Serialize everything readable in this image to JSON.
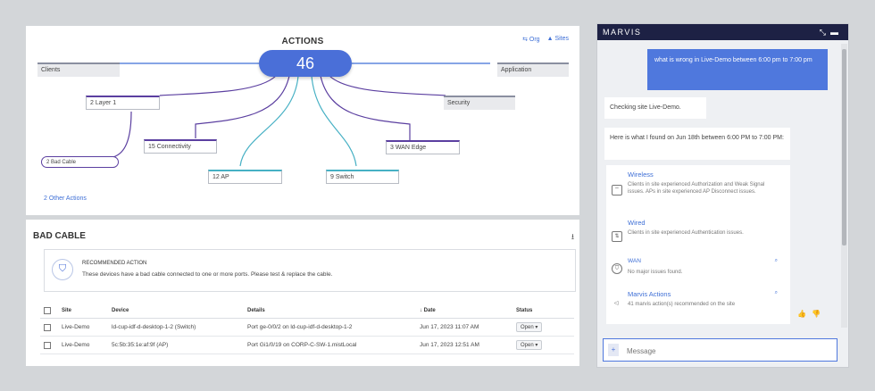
{
  "actions": {
    "title": "ACTIONS",
    "toggle_org": "Org",
    "toggle_sites": "Sites",
    "total_count": "46",
    "node_clients": "Clients",
    "node_application": "Application",
    "node_layer1": "2 Layer 1",
    "node_security": "Security",
    "node_bad_cable": "2   Bad Cable",
    "node_connectivity": "15 Connectivity",
    "node_wan_edge": "3 WAN Edge",
    "node_ap": "12 AP",
    "node_switch": "9 Switch",
    "other_actions": "2 Other Actions"
  },
  "bad_cable": {
    "title": "BAD CABLE",
    "rec_header": "RECOMMENDED ACTION",
    "rec_text": "These devices have a bad cable connected to one or more ports. Please test & replace the cable.",
    "columns": [
      "Site",
      "Device",
      "Details",
      "Date",
      "Status"
    ],
    "rows": [
      {
        "site": "Live-Demo",
        "device": "ld-cup-idf-d-desktop-1-2 (Switch)",
        "details": "Port ge-0/0/2 on ld-cup-idf-d-desktop-1-2",
        "date": "Jun 17, 2023 11:07 AM",
        "status": "Open"
      },
      {
        "site": "Live-Demo",
        "device": "5c:5b:35:1e:af:9f (AP)",
        "details": "Port Gi1/0/19 on CORP-C-SW-1.mistLocal",
        "date": "Jun 17, 2023 12:51 AM",
        "status": "Open"
      }
    ]
  },
  "marvis": {
    "title": "MARVIS",
    "user_message": "what is wrong in Live-Demo between 6:00 pm to 7:00 pm",
    "bot_checking": "Checking site Live-Demo.",
    "bot_found": "Here is what I found on Jun 18th between 6:00 PM to 7:00 PM:",
    "categories": [
      {
        "title": "Wireless",
        "desc": "Clients in site experienced Authorization and Weak Signal issues. APs in site experienced AP Disconnect issues."
      },
      {
        "title": "Wired",
        "desc": "Clients in site experienced Authentication issues."
      },
      {
        "title": "WAN",
        "desc": "No major issues found."
      },
      {
        "title": "Marvis Actions",
        "desc": "41 marvis action(s) recommended on the site"
      }
    ],
    "input_placeholder": "Message"
  },
  "colors": {
    "accent": "#4a6fd8",
    "purple_line": "#5b3fa0",
    "teal_line": "#46b0c4",
    "marvis_header": "#1d2144"
  },
  "icons": [
    "download-icon",
    "shield-icon",
    "expand-icon",
    "minimize-icon",
    "thumbs-up-icon",
    "thumbs-down-icon",
    "plus-icon",
    "wifi-icon",
    "switch-icon",
    "wan-icon",
    "actions-icon"
  ]
}
